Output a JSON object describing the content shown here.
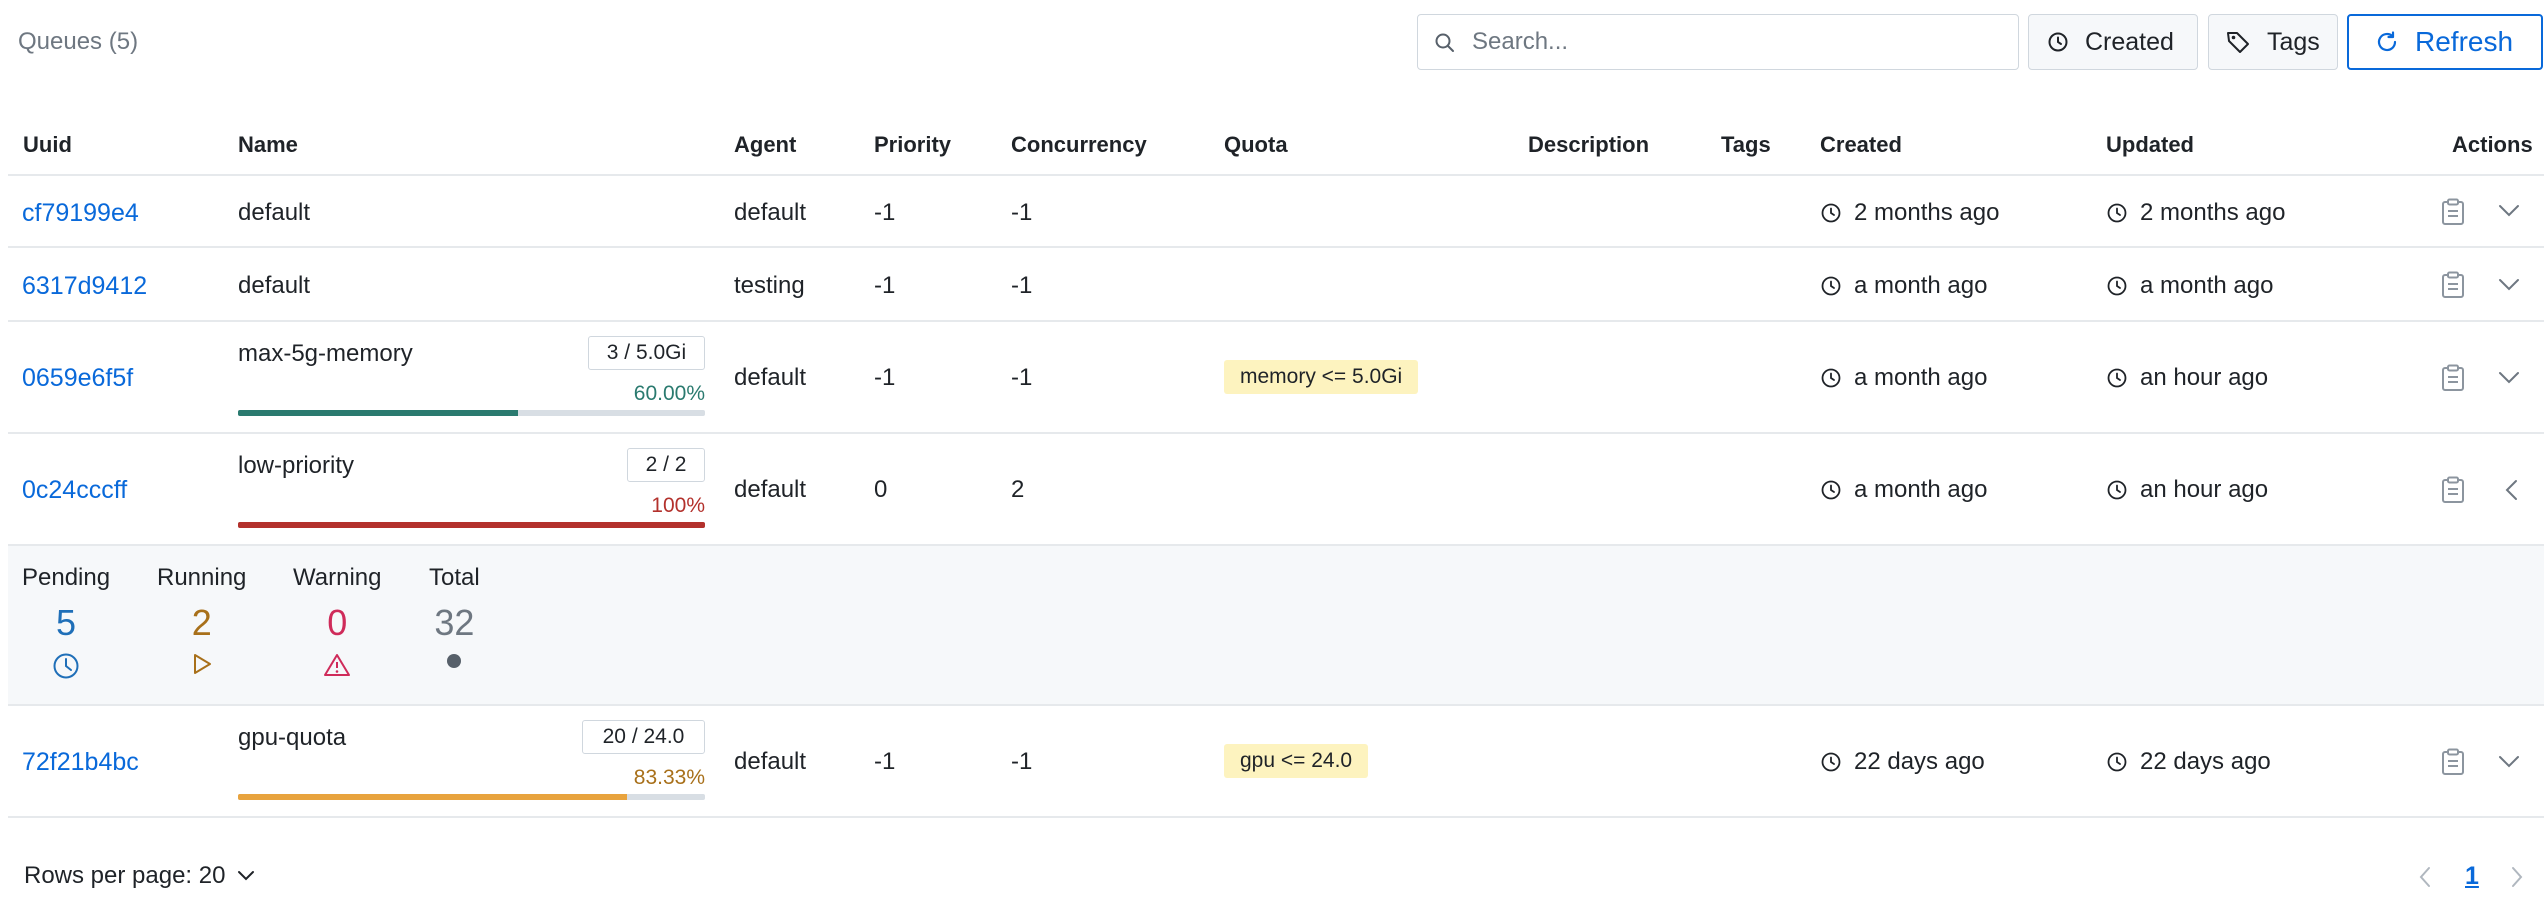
{
  "header": {
    "queues_title": "Queues (5)",
    "search_placeholder": "Search...",
    "created_label": "Created",
    "tags_label": "Tags",
    "refresh_label": "Refresh"
  },
  "columns": [
    "Uuid",
    "Name",
    "Agent",
    "Priority",
    "Concurrency",
    "Quota",
    "Description",
    "Tags",
    "Created",
    "Updated",
    "Actions"
  ],
  "rows": [
    {
      "uuid": "cf79199e4",
      "name": "default",
      "agent": "default",
      "priority": "-1",
      "concurrency": "-1",
      "created": "2 months ago",
      "updated": "2 months ago"
    },
    {
      "uuid": "6317d9412",
      "name": "default",
      "agent": "testing",
      "priority": "-1",
      "concurrency": "-1",
      "created": "a month ago",
      "updated": "a month ago"
    },
    {
      "uuid": "0659e6f5f",
      "name": "max-5g-memory",
      "capacity": "3 / 5.0Gi",
      "percent": "60.00%",
      "usage_fraction": 0.6,
      "bar_color": "#2a7a6f",
      "agent": "default",
      "priority": "-1",
      "concurrency": "-1",
      "quota": "memory <= 5.0Gi",
      "created": "a month ago",
      "updated": "an hour ago"
    },
    {
      "uuid": "0c24cccff",
      "name": "low-priority",
      "capacity": "2 / 2",
      "percent": "100%",
      "usage_fraction": 1.0,
      "bar_color": "#b3312c",
      "agent": "default",
      "priority": "0",
      "concurrency": "2",
      "created": "a month ago",
      "updated": "an hour ago"
    },
    {
      "uuid": "72f21b4bc",
      "name": "gpu-quota",
      "capacity": "20 / 24.0",
      "percent": "83.33%",
      "usage_fraction": 0.8333,
      "bar_color": "#e8a33d",
      "agent": "default",
      "priority": "-1",
      "concurrency": "-1",
      "quota": "gpu <= 24.0",
      "created": "22 days ago",
      "updated": "22 days ago"
    }
  ],
  "expanded_stats": {
    "pending_label": "Pending",
    "pending_value": "5",
    "pending_color": "#1f6fb8",
    "running_label": "Running",
    "running_value": "2",
    "running_color": "#a8701a",
    "warning_label": "Warning",
    "warning_value": "0",
    "warning_color": "#cf2b5a",
    "total_label": "Total",
    "total_value": "32",
    "total_color": "#6e7781"
  },
  "footer": {
    "rows_per_page": "Rows per page: 20",
    "current_page": "1"
  },
  "colors": {
    "link": "#0969da",
    "quota_bg": "#fdf3bf"
  }
}
